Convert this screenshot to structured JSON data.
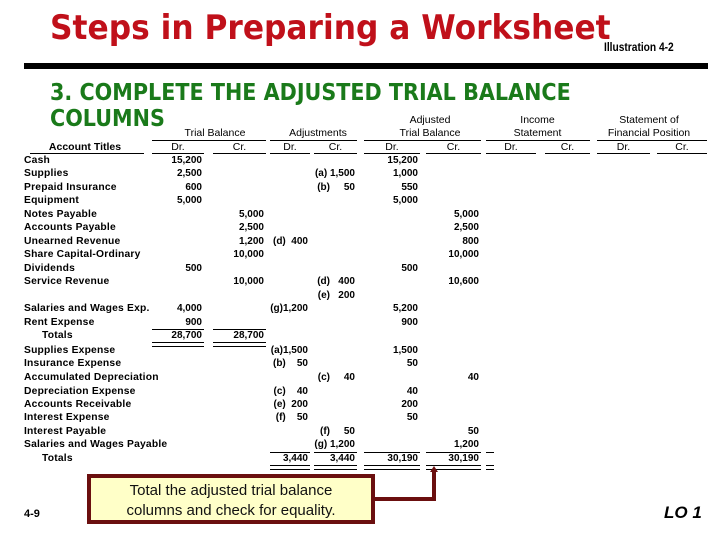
{
  "header": {
    "title": "Steps in Preparing a Worksheet",
    "illustration": "Illustration 4-2",
    "subtitle": "3. COMPLETE THE ADJUSTED TRIAL BALANCE COLUMNS"
  },
  "worksheet": {
    "group_headers": {
      "trial_balance": "Trial Balance",
      "adjustments": "Adjustments",
      "adjusted_line1": "Adjusted",
      "adjusted_line2": "Trial Balance",
      "income_line1": "Income",
      "income_line2": "Statement",
      "sofp_line1": "Statement of",
      "sofp_line2": "Financial Position"
    },
    "account_titles_header": "Account Titles",
    "dr": "Dr.",
    "cr": "Cr.",
    "rows": [
      {
        "account": "Cash",
        "tb_dr": "15,200",
        "tb_cr": "",
        "adj_dr": "",
        "adj_cr": "",
        "atb_dr": "15,200",
        "atb_cr": ""
      },
      {
        "account": "Supplies",
        "tb_dr": "2,500",
        "tb_cr": "",
        "adj_dr": "",
        "adj_cr": "(a) 1,500",
        "atb_dr": "1,000",
        "atb_cr": ""
      },
      {
        "account": "Prepaid Insurance",
        "tb_dr": "600",
        "tb_cr": "",
        "adj_dr": "",
        "adj_cr": "(b)     50",
        "atb_dr": "550",
        "atb_cr": ""
      },
      {
        "account": "Equipment",
        "tb_dr": "5,000",
        "tb_cr": "",
        "adj_dr": "",
        "adj_cr": "",
        "atb_dr": "5,000",
        "atb_cr": ""
      },
      {
        "account": "Notes Payable",
        "tb_dr": "",
        "tb_cr": "5,000",
        "adj_dr": "",
        "adj_cr": "",
        "atb_dr": "",
        "atb_cr": "5,000"
      },
      {
        "account": "Accounts Payable",
        "tb_dr": "",
        "tb_cr": "2,500",
        "adj_dr": "",
        "adj_cr": "",
        "atb_dr": "",
        "atb_cr": "2,500"
      },
      {
        "account": "Unearned Revenue",
        "tb_dr": "",
        "tb_cr": "1,200",
        "adj_dr": "(d)  400",
        "adj_cr": "",
        "atb_dr": "",
        "atb_cr": "800"
      },
      {
        "account": "Share Capital-Ordinary",
        "tb_dr": "",
        "tb_cr": "10,000",
        "adj_dr": "",
        "adj_cr": "",
        "atb_dr": "",
        "atb_cr": "10,000"
      },
      {
        "account": "Dividends",
        "tb_dr": "500",
        "tb_cr": "",
        "adj_dr": "",
        "adj_cr": "",
        "atb_dr": "500",
        "atb_cr": ""
      },
      {
        "account": "Service Revenue",
        "tb_dr": "",
        "tb_cr": "10,000",
        "adj_dr": "",
        "adj_cr": "(d)   400",
        "atb_dr": "",
        "atb_cr": "10,600"
      },
      {
        "account": "",
        "tb_dr": "",
        "tb_cr": "",
        "adj_dr": "",
        "adj_cr": "(e)   200",
        "atb_dr": "",
        "atb_cr": ""
      },
      {
        "account": "Salaries and Wages Exp.",
        "tb_dr": "4,000",
        "tb_cr": "",
        "adj_dr": "(g)1,200",
        "adj_cr": "",
        "atb_dr": "5,200",
        "atb_cr": ""
      },
      {
        "account": "Rent Expense",
        "tb_dr": "900",
        "tb_cr": "",
        "adj_dr": "",
        "adj_cr": "",
        "atb_dr": "900",
        "atb_cr": ""
      },
      {
        "account": "Totals",
        "tb_dr": "28,700",
        "tb_cr": "28,700",
        "adj_dr": "",
        "adj_cr": "",
        "atb_dr": "",
        "atb_cr": ""
      },
      {
        "account": "Supplies Expense",
        "tb_dr": "",
        "tb_cr": "",
        "adj_dr": "(a)1,500",
        "adj_cr": "",
        "atb_dr": "1,500",
        "atb_cr": ""
      },
      {
        "account": "Insurance Expense",
        "tb_dr": "",
        "tb_cr": "",
        "adj_dr": "(b)    50",
        "adj_cr": "",
        "atb_dr": "50",
        "atb_cr": ""
      },
      {
        "account": "Accumulated Depreciation",
        "tb_dr": "",
        "tb_cr": "",
        "adj_dr": "",
        "adj_cr": "(c)     40",
        "atb_dr": "",
        "atb_cr": "40"
      },
      {
        "account": "Depreciation Expense",
        "tb_dr": "",
        "tb_cr": "",
        "adj_dr": "(c)    40",
        "adj_cr": "",
        "atb_dr": "40",
        "atb_cr": ""
      },
      {
        "account": "Accounts Receivable",
        "tb_dr": "",
        "tb_cr": "",
        "adj_dr": "(e)  200",
        "adj_cr": "",
        "atb_dr": "200",
        "atb_cr": ""
      },
      {
        "account": "Interest Expense",
        "tb_dr": "",
        "tb_cr": "",
        "adj_dr": "(f)    50",
        "adj_cr": "",
        "atb_dr": "50",
        "atb_cr": ""
      },
      {
        "account": "Interest Payable",
        "tb_dr": "",
        "tb_cr": "",
        "adj_dr": "",
        "adj_cr": "(f)     50",
        "atb_dr": "",
        "atb_cr": "50"
      },
      {
        "account": "Salaries and Wages Payable",
        "tb_dr": "",
        "tb_cr": "",
        "adj_dr": "",
        "adj_cr": "(g) 1,200",
        "atb_dr": "",
        "atb_cr": "1,200"
      },
      {
        "account": "Totals",
        "tb_dr": "",
        "tb_cr": "",
        "adj_dr": "3,440",
        "adj_cr": "3,440",
        "atb_dr": "30,190",
        "atb_cr": "30,190"
      }
    ]
  },
  "callout": {
    "line1": "Total the adjusted trial balance",
    "line2": "columns and check for equality."
  },
  "footer": {
    "page_number": "4-9",
    "learning_objective": "LO 1"
  }
}
